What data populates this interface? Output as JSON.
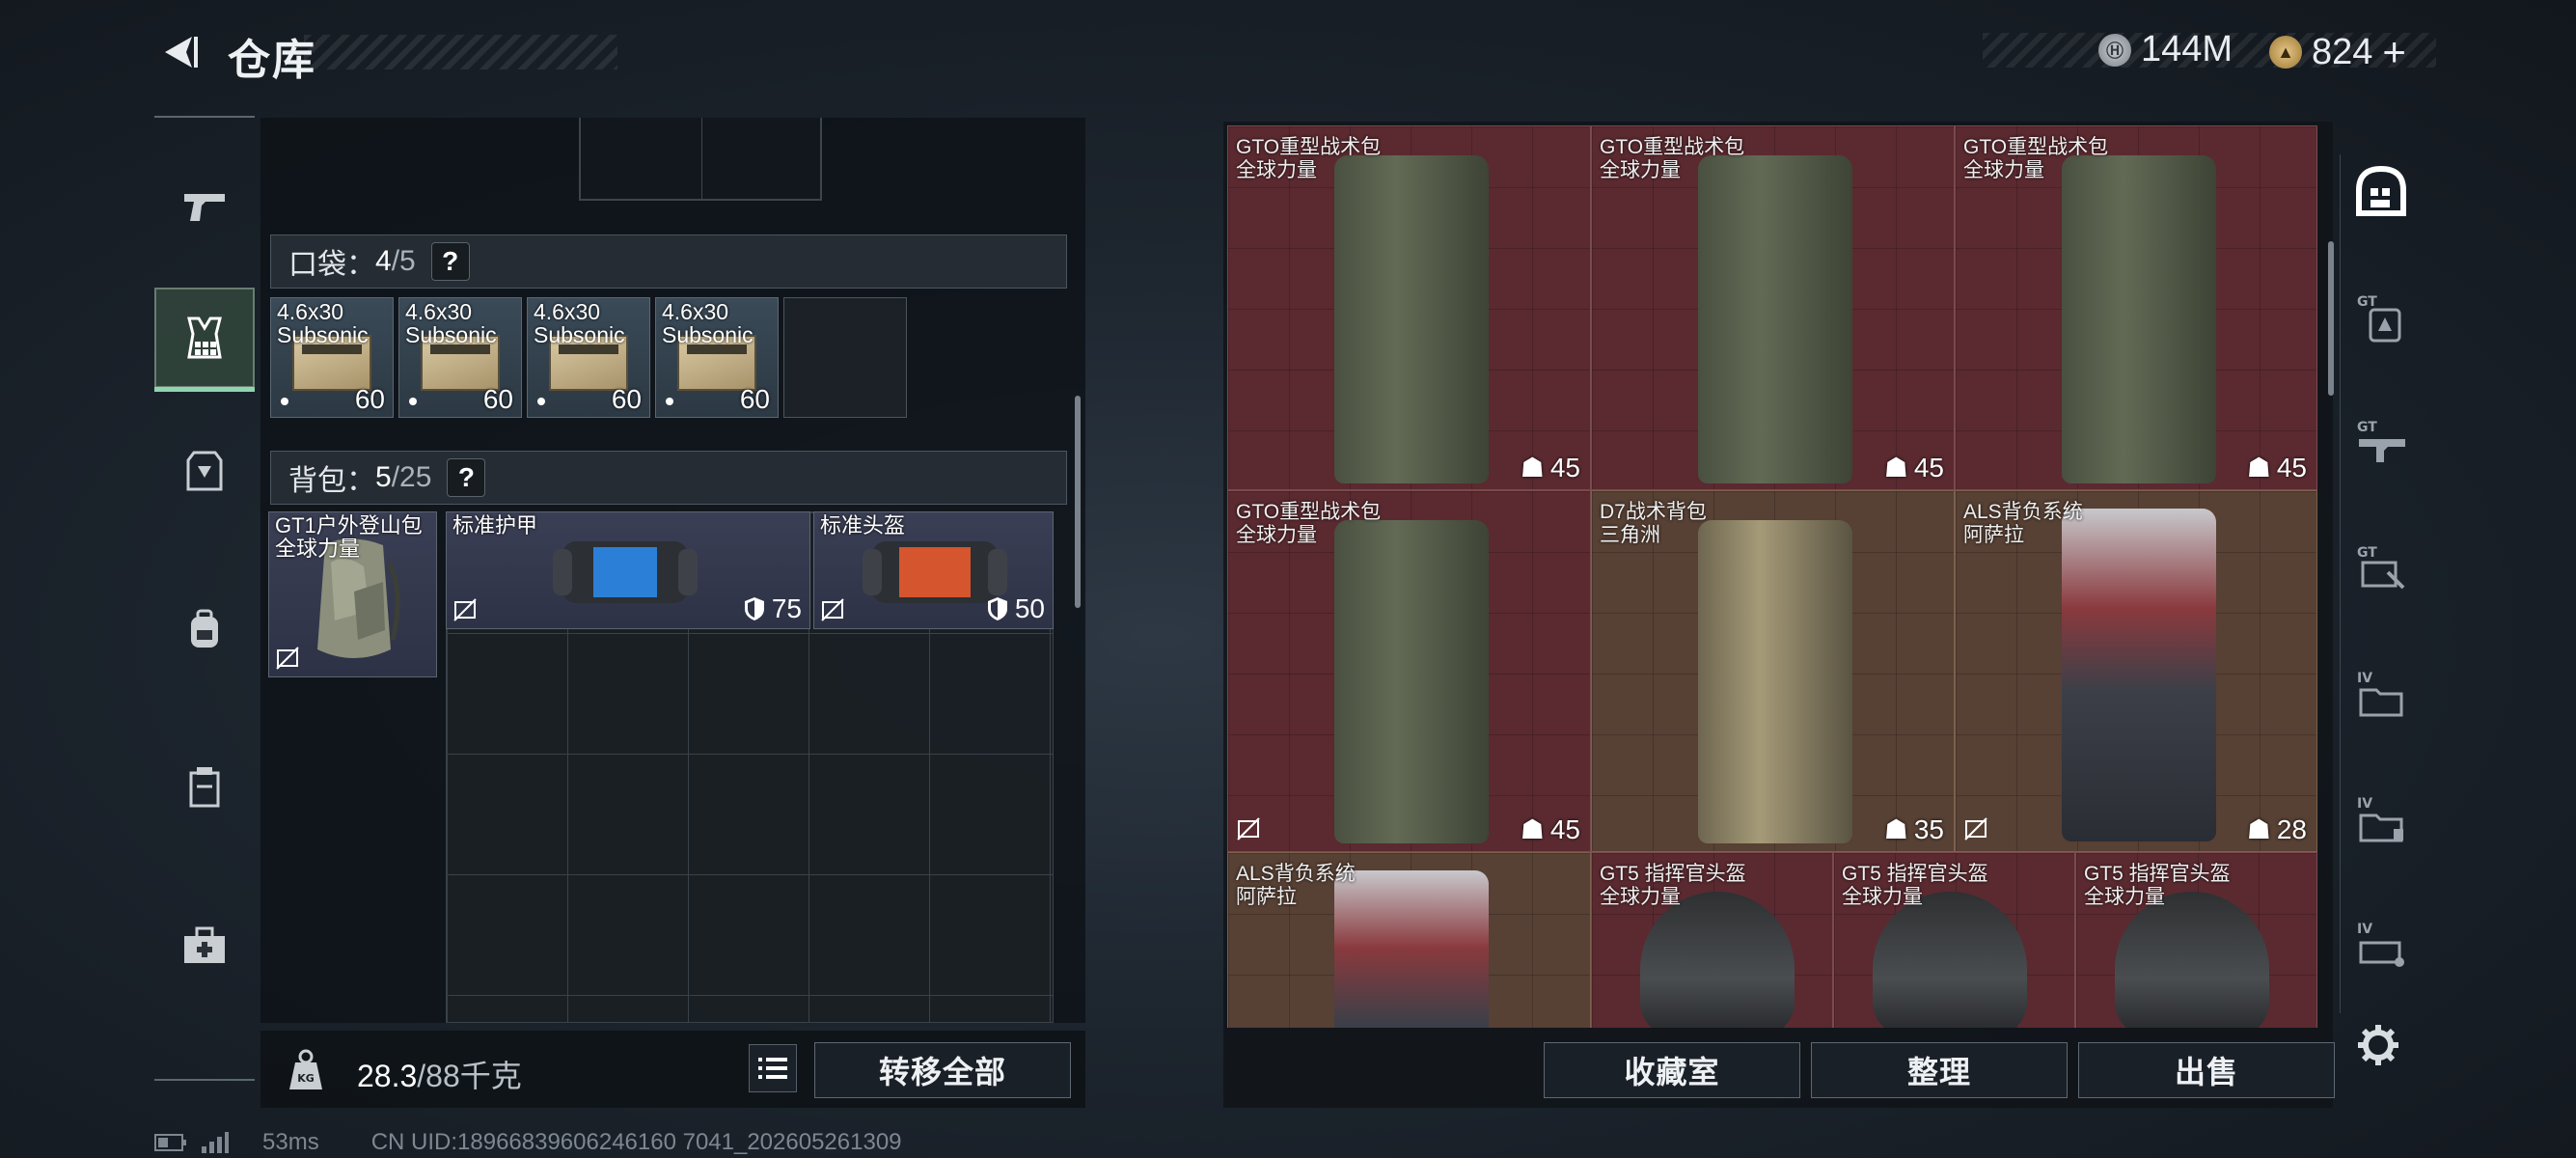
{
  "header": {
    "title": "仓库",
    "currency_silver": "144M",
    "currency_gold": "824",
    "add_symbol": "+"
  },
  "left_rail": {
    "items": [
      {
        "icon": "pistol-icon"
      },
      {
        "icon": "vest-icon",
        "active": true
      },
      {
        "icon": "armor-icon"
      },
      {
        "icon": "backpack-icon"
      },
      {
        "icon": "container-icon"
      },
      {
        "icon": "medkit-icon"
      }
    ]
  },
  "pocket": {
    "label": "口袋：",
    "current": "4",
    "max": "/5",
    "help": "?",
    "items": [
      {
        "name_line1": "4.6x30",
        "name_line2": "Subsonic",
        "count": "60"
      },
      {
        "name_line1": "4.6x30",
        "name_line2": "Subsonic",
        "count": "60"
      },
      {
        "name_line1": "4.6x30",
        "name_line2": "Subsonic",
        "count": "60"
      },
      {
        "name_line1": "4.6x30",
        "name_line2": "Subsonic",
        "count": "60"
      }
    ]
  },
  "backpack": {
    "label": "背包：",
    "current": "5",
    "max": "/25",
    "help": "?",
    "items": [
      {
        "name_line1": "GT1户外登山包",
        "name_line2": "全球力量"
      },
      {
        "name_line1": "标准护甲",
        "value": "75"
      },
      {
        "name_line1": "标准头盔",
        "value": "50"
      }
    ]
  },
  "weight": {
    "current": "28.3",
    "max": "/88千克"
  },
  "actions": {
    "transfer_all": "转移全部",
    "collection": "收藏室",
    "organize": "整理",
    "sell": "出售"
  },
  "status_bar": {
    "ping": "53ms",
    "uid": "CN UID:18966839606246160 7041_202605261309"
  },
  "storage": {
    "rows": [
      [
        {
          "name": "GTO重型战术包",
          "sub": "全球力量",
          "value": "45"
        },
        {
          "name": "GTO重型战术包",
          "sub": "全球力量",
          "value": "45"
        },
        {
          "name": "GTO重型战术包",
          "sub": "全球力量",
          "value": "45"
        }
      ],
      [
        {
          "name": "GTO重型战术包",
          "sub": "全球力量",
          "value": "45"
        },
        {
          "name": "D7战术背包",
          "sub": "三角洲",
          "value": "35"
        },
        {
          "name": "ALS背负系统",
          "sub": "阿萨拉",
          "value": "28"
        }
      ],
      [
        {
          "name": "ALS背负系统",
          "sub": "阿萨拉"
        },
        {
          "name": "GT5 指挥官头盔",
          "sub": "全球力量"
        },
        {
          "name": "GT5 指挥官头盔",
          "sub": "全球力量"
        },
        {
          "name": "GT5 指挥官头盔",
          "sub": "全球力量"
        }
      ]
    ]
  },
  "right_rail": {
    "items": [
      {
        "icon": "all-items-icon",
        "active": true
      },
      {
        "icon": "gt-backpack-filter-icon",
        "label": "GT"
      },
      {
        "icon": "gt-weapon-filter-icon",
        "label": "GT"
      },
      {
        "icon": "gt-gear-filter-icon",
        "label": "GT"
      },
      {
        "icon": "iv-filter-icon",
        "label": "IV"
      },
      {
        "icon": "iv-folder-filter-icon",
        "label": "IV"
      },
      {
        "icon": "iv-vehicle-filter-icon",
        "label": "IV"
      },
      {
        "icon": "settings-icon"
      }
    ]
  },
  "colors": {
    "accent_green": "#8fd6b0",
    "storage_red": "#5a2a30",
    "storage_gold": "#574034",
    "pocket_slot": "#3a4a57"
  }
}
